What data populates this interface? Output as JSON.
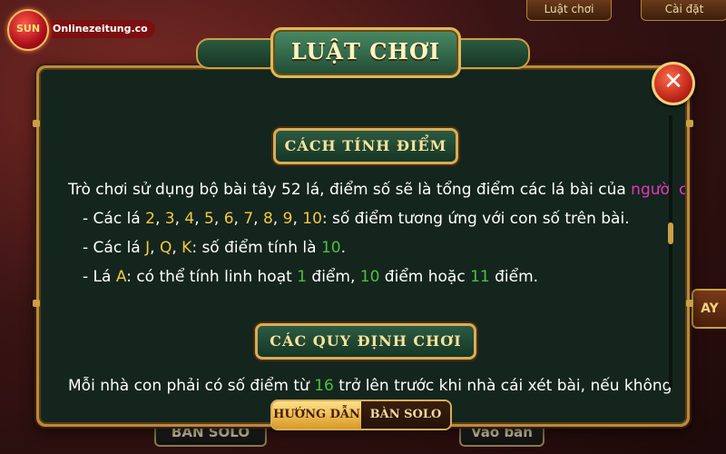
{
  "app": {
    "logo_text": "SUN",
    "watermark": "Onlinezeitung.co"
  },
  "background": {
    "top_tabs": [
      "Luật chơi",
      "Cài đặt"
    ],
    "bottom_left_button": "BAN SOLO",
    "bottom_right_button": "Vào bàn",
    "side_button": "AY"
  },
  "dialog": {
    "title": "LUẬT CHƠI",
    "close_symbol": "✕",
    "sections": [
      {
        "header": "CÁCH TÍNH ĐIỂM",
        "intro": {
          "prefix": "Trò chơi sử dụng bộ bài tây 52 lá, điểm số sẽ là tổng điểm các lá bài của ",
          "highlight": "người chơi",
          "suffix": ":"
        },
        "bullets": [
          {
            "prefix": "- Các lá ",
            "cards": [
              "2",
              "3",
              "4",
              "5",
              "6",
              "7",
              "8",
              "9",
              "10"
            ],
            "suffix": ": số điểm tương ứng với con số trên bài."
          },
          {
            "prefix": "- Các lá ",
            "cards": [
              "J",
              "Q",
              "K"
            ],
            "middle": ": số điểm tính là ",
            "value": "10",
            "suffix": "."
          },
          {
            "prefix": "- Lá ",
            "card": "A",
            "middle": ": có thể tính linh hoạt ",
            "values": [
              "1",
              "10",
              "11"
            ],
            "joiners": [
              " điểm, ",
              " điểm hoặc ",
              " điểm."
            ]
          }
        ]
      },
      {
        "header": "CÁC QUY ĐỊNH CHƠI",
        "text": {
          "prefix": "Mỗi nhà con phải có số điểm từ ",
          "value": "16",
          "suffix": " trở lên trước khi nhà cái xét bài, nếu không"
        }
      }
    ],
    "tabs": [
      {
        "label": "HƯỚNG DẪN",
        "active": true
      },
      {
        "label": "BÀN SOLO",
        "active": false
      }
    ]
  },
  "colors": {
    "highlight_yellow": "#f4c93f",
    "highlight_green": "#4ec03a",
    "highlight_pink": "#e23ab8",
    "panel_bg": "#14251e",
    "gold_border": "#d7ad58"
  }
}
